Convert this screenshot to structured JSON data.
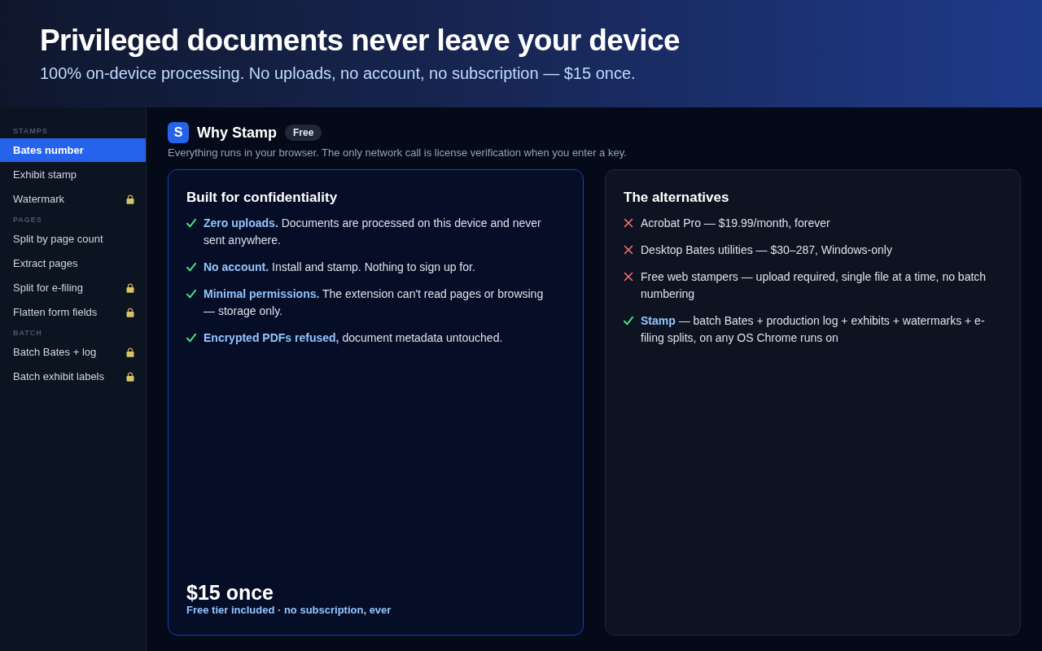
{
  "header": {
    "title": "Privileged documents never leave your device",
    "subtitle": "100% on-device processing. No uploads, no account, no subscription — $15 once."
  },
  "sidebar": {
    "sections": [
      {
        "label": "STAMPS",
        "items": [
          {
            "label": "Bates number",
            "selected": true,
            "locked": false
          },
          {
            "label": "Exhibit stamp",
            "selected": false,
            "locked": false
          },
          {
            "label": "Watermark",
            "selected": false,
            "locked": true
          }
        ]
      },
      {
        "label": "PAGES",
        "items": [
          {
            "label": "Split by page count",
            "selected": false,
            "locked": false
          },
          {
            "label": "Extract pages",
            "selected": false,
            "locked": false
          },
          {
            "label": "Split for e-filing",
            "selected": false,
            "locked": true
          },
          {
            "label": "Flatten form fields",
            "selected": false,
            "locked": true
          }
        ]
      },
      {
        "label": "BATCH",
        "items": [
          {
            "label": "Batch Bates + log",
            "selected": false,
            "locked": true
          },
          {
            "label": "Batch exhibit labels",
            "selected": false,
            "locked": true
          }
        ]
      }
    ]
  },
  "main": {
    "logo_letter": "S",
    "title": "Why Stamp",
    "badge": "Free",
    "description": "Everything runs in your browser. The only network call is license verification when you enter a key.",
    "cards": [
      {
        "kind": "highlight",
        "title": "Built for confidentiality",
        "items": [
          {
            "kind": "check",
            "text": "**Zero uploads.** Documents are processed on this device and never sent anywhere."
          },
          {
            "kind": "check",
            "text": "**No account.** Install and stamp. Nothing to sign up for."
          },
          {
            "kind": "check",
            "text": "**Minimal permissions.** The extension can't read pages or browsing — storage only."
          },
          {
            "kind": "check",
            "text": "**Encrypted PDFs refused,** document metadata untouched."
          }
        ],
        "price": "$15 once",
        "price_note": "Free tier included · no subscription, ever"
      },
      {
        "kind": "plain",
        "title": "The alternatives",
        "items": [
          {
            "kind": "cross",
            "text": "Acrobat Pro — $19.99/month, forever"
          },
          {
            "kind": "cross",
            "text": "Desktop Bates utilities — $30–287, Windows-only"
          },
          {
            "kind": "cross",
            "text": "Free web stampers — upload required, single file at a time, no batch numbering"
          },
          {
            "kind": "check",
            "text": "**Stamp** — batch Bates + production log + exhibits + watermarks + e-filing splits, on any OS Chrome runs on"
          }
        ]
      }
    ]
  }
}
